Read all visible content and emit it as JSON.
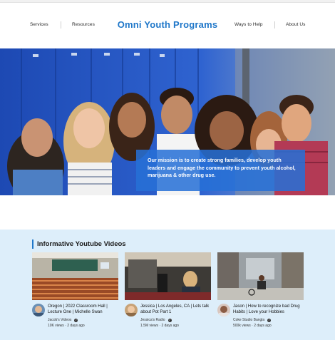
{
  "nav": {
    "left": [
      "Services",
      "Resources"
    ],
    "brand": "Omni Youth Programs",
    "right": [
      "Ways to Help",
      "About Us"
    ]
  },
  "hero": {
    "mission": "Our mission is to create strong families, develop youth leaders and engage the community to prevent youth alcohol, marijuana & other drug use."
  },
  "videos": {
    "heading": "Informative Youtube Videos",
    "items": [
      {
        "title": "Oregon | 2022 Classroom Hall | Lecture One | Michelle Swan",
        "channel": "Jacob's Videos",
        "views": "10K views",
        "age": "2 days ago"
      },
      {
        "title": "Jessica | Los Angeles, CA | Lets talk about Pot Part 1",
        "channel": "Jessica's Radio",
        "views": "1.5M views",
        "age": "2 days ago"
      },
      {
        "title": "Jason | How to recognize bad Drug Habits | Love your Hobbies",
        "channel": "Coke Studio Bangla",
        "views": "500k views",
        "age": "2 days ago"
      }
    ]
  },
  "icons": {
    "verified": "verified-check-icon"
  },
  "colors": {
    "brand": "#1f77c9",
    "mission_bg": "#2670d6",
    "videos_bg": "#ddeefa"
  }
}
